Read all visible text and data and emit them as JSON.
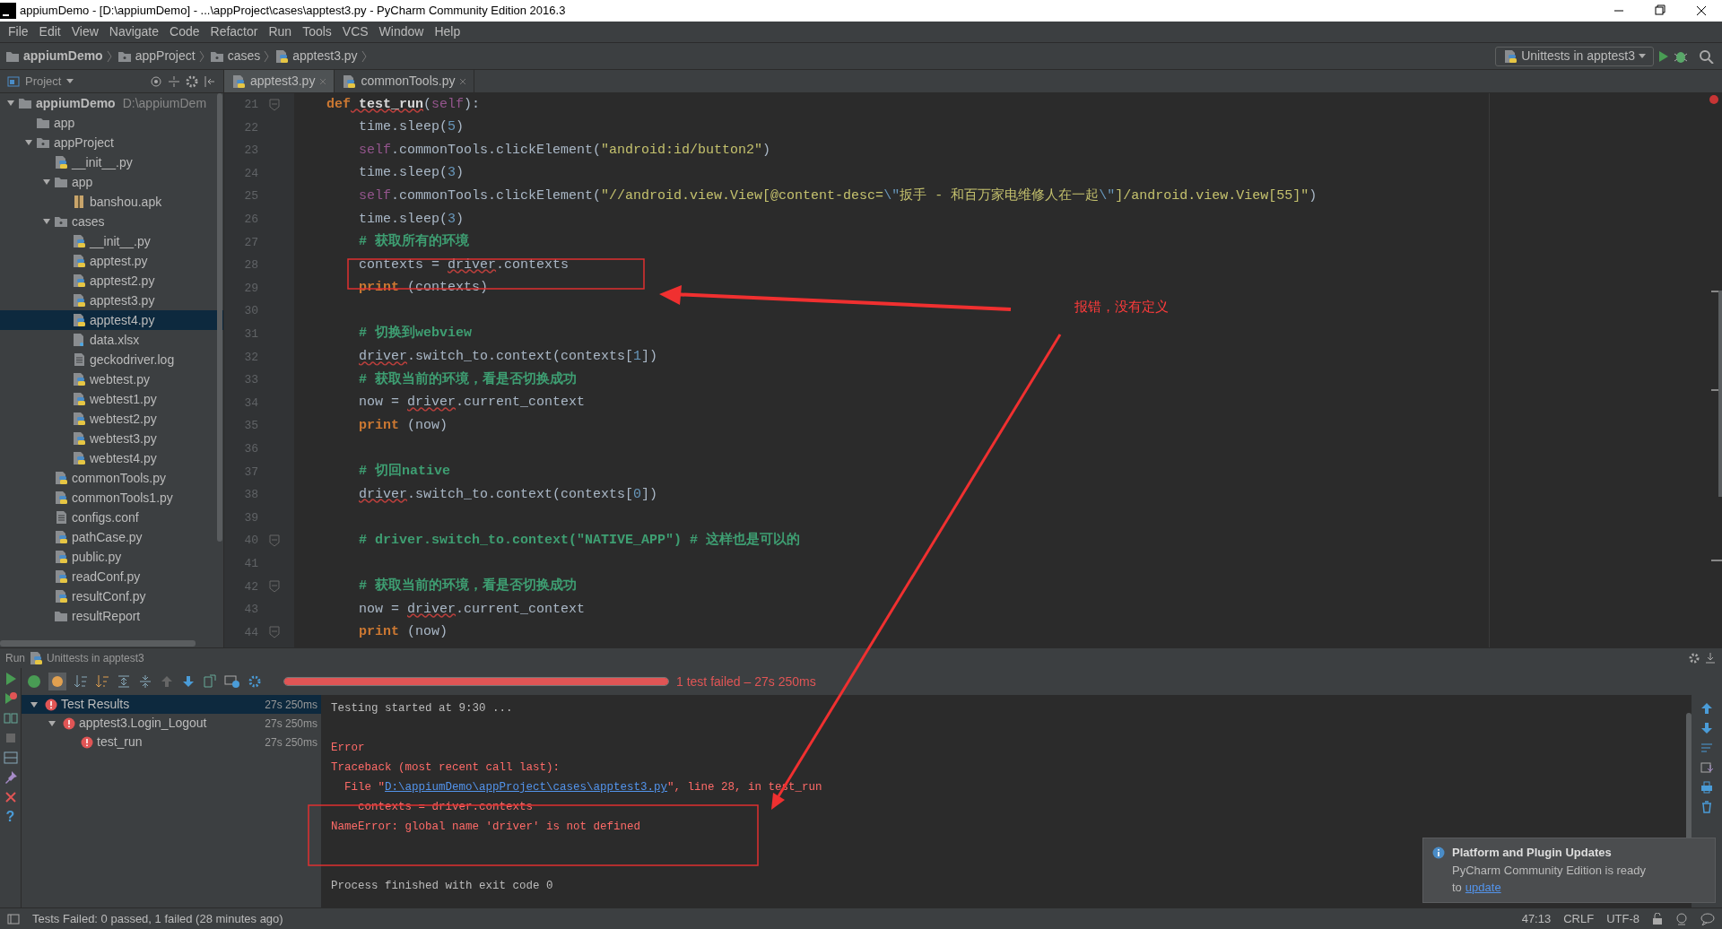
{
  "window": {
    "title": "appiumDemo - [D:\\appiumDemo] - ...\\appProject\\cases\\apptest3.py - PyCharm Community Edition 2016.3"
  },
  "menu": [
    "File",
    "Edit",
    "View",
    "Navigate",
    "Code",
    "Refactor",
    "Run",
    "Tools",
    "VCS",
    "Window",
    "Help"
  ],
  "breadcrumbs": [
    {
      "label": "appiumDemo",
      "kind": "root"
    },
    {
      "label": "appProject",
      "kind": "package"
    },
    {
      "label": "cases",
      "kind": "package"
    },
    {
      "label": "apptest3.py",
      "kind": "py"
    }
  ],
  "run_config": {
    "label": "Unittests in apptest3"
  },
  "project_panel": {
    "title": "Project"
  },
  "tabs": [
    {
      "label": "apptest3.py",
      "selected": true
    },
    {
      "label": "commonTools.py",
      "selected": false
    }
  ],
  "tree": [
    {
      "name": "appiumDemo",
      "path": "D:\\appiumDem",
      "kind": "folder",
      "expanded": true,
      "selected": false,
      "children": [
        {
          "name": "app",
          "kind": "folder",
          "selected": false
        },
        {
          "name": "appProject",
          "kind": "package",
          "expanded": true,
          "selected": false,
          "children": [
            {
              "name": "__init__.py",
              "kind": "py",
              "selected": false
            },
            {
              "name": "app",
              "kind": "folder",
              "expanded": true,
              "selected": false,
              "children": [
                {
                  "name": "banshou.apk",
                  "kind": "apk",
                  "selected": false
                }
              ]
            },
            {
              "name": "cases",
              "kind": "package",
              "expanded": true,
              "selected": false,
              "children": [
                {
                  "name": "__init__.py",
                  "kind": "py",
                  "selected": false
                },
                {
                  "name": "apptest.py",
                  "kind": "py",
                  "selected": false
                },
                {
                  "name": "apptest2.py",
                  "kind": "py",
                  "selected": false
                },
                {
                  "name": "apptest3.py",
                  "kind": "py",
                  "selected": false
                },
                {
                  "name": "apptest4.py",
                  "kind": "py",
                  "selected": true
                },
                {
                  "name": "data.xlsx",
                  "kind": "unknown",
                  "selected": false
                },
                {
                  "name": "geckodriver.log",
                  "kind": "text",
                  "selected": false
                },
                {
                  "name": "webtest.py",
                  "kind": "py",
                  "selected": false
                },
                {
                  "name": "webtest1.py",
                  "kind": "py",
                  "selected": false
                },
                {
                  "name": "webtest2.py",
                  "kind": "py",
                  "selected": false
                },
                {
                  "name": "webtest3.py",
                  "kind": "py",
                  "selected": false
                },
                {
                  "name": "webtest4.py",
                  "kind": "py",
                  "selected": false
                }
              ]
            },
            {
              "name": "commonTools.py",
              "kind": "py",
              "selected": false
            },
            {
              "name": "commonTools1.py",
              "kind": "py",
              "selected": false
            },
            {
              "name": "configs.conf",
              "kind": "text",
              "selected": false
            },
            {
              "name": "pathCase.py",
              "kind": "py",
              "selected": false
            },
            {
              "name": "public.py",
              "kind": "py",
              "selected": false
            },
            {
              "name": "readConf.py",
              "kind": "py",
              "selected": false
            },
            {
              "name": "resultConf.py",
              "kind": "py",
              "selected": false
            },
            {
              "name": "resultReport",
              "kind": "folder",
              "selected": false
            }
          ]
        }
      ]
    }
  ],
  "editor": {
    "lines": [
      {
        "no": "21",
        "kind": "def",
        "fold_marker": true,
        "segments": [
          {
            "t": "def",
            "kind": "kw"
          },
          {
            "t": " test_run",
            "kind": "fn"
          },
          {
            "t": "(",
            "kind": "plain"
          },
          {
            "t": "self",
            "kind": "self"
          },
          {
            "t": "):",
            "kind": "plain"
          }
        ]
      },
      {
        "no": "22",
        "kind": "body",
        "segments": [
          {
            "t": "time.sleep(",
            "kind": "plain"
          },
          {
            "t": "5",
            "kind": "num"
          },
          {
            "t": ")",
            "kind": "plain"
          }
        ]
      },
      {
        "no": "23",
        "kind": "body",
        "segments": [
          {
            "t": "self",
            "kind": "self"
          },
          {
            "t": ".commonTools.clickElement(",
            "kind": "plain"
          },
          {
            "t": "\"android:id/button2\"",
            "kind": "str"
          },
          {
            "t": ")",
            "kind": "plain"
          }
        ]
      },
      {
        "no": "24",
        "kind": "body",
        "segments": [
          {
            "t": "time.sleep(",
            "kind": "plain"
          },
          {
            "t": "3",
            "kind": "num"
          },
          {
            "t": ")",
            "kind": "plain"
          }
        ]
      },
      {
        "no": "25",
        "kind": "body",
        "segments": [
          {
            "t": "self",
            "kind": "self"
          },
          {
            "t": ".commonTools.clickElement(",
            "kind": "plain"
          },
          {
            "t": "\"//android.view.View[@content-desc=",
            "kind": "str"
          },
          {
            "t": "\\\"",
            "kind": "esc"
          },
          {
            "t": "扳手 - 和百万家电维修人在一起",
            "kind": "str"
          },
          {
            "t": "\\\"",
            "kind": "esc"
          },
          {
            "t": "]/android.view.View[55]\"",
            "kind": "str"
          },
          {
            "t": ")",
            "kind": "plain"
          }
        ]
      },
      {
        "no": "26",
        "kind": "body",
        "segments": [
          {
            "t": "time.sleep(",
            "kind": "plain"
          },
          {
            "t": "3",
            "kind": "num"
          },
          {
            "t": ")",
            "kind": "plain"
          }
        ]
      },
      {
        "no": "27",
        "kind": "body",
        "segments": [
          {
            "t": "# 获取所有的环境",
            "kind": "cmt"
          }
        ]
      },
      {
        "no": "28",
        "kind": "body",
        "segments": [
          {
            "t": "contexts = ",
            "kind": "plain"
          },
          {
            "t": "driver",
            "kind": "warn"
          },
          {
            "t": ".contexts",
            "kind": "plain"
          }
        ]
      },
      {
        "no": "29",
        "kind": "body",
        "segments": [
          {
            "t": "print",
            "kind": "kw"
          },
          {
            "t": " (contexts)",
            "kind": "plain"
          }
        ]
      },
      {
        "no": "30",
        "kind": "blank"
      },
      {
        "no": "31",
        "kind": "body",
        "segments": [
          {
            "t": "# 切换到webview",
            "kind": "cmt"
          }
        ]
      },
      {
        "no": "32",
        "kind": "body",
        "segments": [
          {
            "t": "driver",
            "kind": "warn"
          },
          {
            "t": ".switch_to.context(contexts[",
            "kind": "plain"
          },
          {
            "t": "1",
            "kind": "num"
          },
          {
            "t": "])",
            "kind": "plain"
          }
        ]
      },
      {
        "no": "33",
        "kind": "body",
        "segments": [
          {
            "t": "# 获取当前的环境，看是否切换成功",
            "kind": "cmt"
          }
        ]
      },
      {
        "no": "34",
        "kind": "body",
        "segments": [
          {
            "t": "now = ",
            "kind": "plain"
          },
          {
            "t": "driver",
            "kind": "warn"
          },
          {
            "t": ".current_context",
            "kind": "plain"
          }
        ]
      },
      {
        "no": "35",
        "kind": "body",
        "segments": [
          {
            "t": "print",
            "kind": "kw"
          },
          {
            "t": " (now)",
            "kind": "plain"
          }
        ]
      },
      {
        "no": "36",
        "kind": "blank"
      },
      {
        "no": "37",
        "kind": "body",
        "segments": [
          {
            "t": "# 切回native",
            "kind": "cmt"
          }
        ]
      },
      {
        "no": "38",
        "kind": "body",
        "segments": [
          {
            "t": "driver",
            "kind": "warn"
          },
          {
            "t": ".switch_to.context(contexts[",
            "kind": "plain"
          },
          {
            "t": "0",
            "kind": "num"
          },
          {
            "t": "])",
            "kind": "plain"
          }
        ]
      },
      {
        "no": "39",
        "kind": "blank"
      },
      {
        "no": "40",
        "kind": "body",
        "fold_marker": true,
        "segments": [
          {
            "t": "# driver.switch_to.context(\"NATIVE_APP\") # 这样也是可以的",
            "kind": "cmt"
          }
        ]
      },
      {
        "no": "41",
        "kind": "blank"
      },
      {
        "no": "42",
        "kind": "body",
        "fold_marker": true,
        "segments": [
          {
            "t": "# 获取当前的环境，看是否切换成功",
            "kind": "cmt"
          }
        ]
      },
      {
        "no": "43",
        "kind": "body",
        "segments": [
          {
            "t": "now = ",
            "kind": "plain"
          },
          {
            "t": "driver",
            "kind": "warn"
          },
          {
            "t": ".current_context",
            "kind": "plain"
          }
        ]
      },
      {
        "no": "44",
        "kind": "body",
        "fold_marker": true,
        "segments": [
          {
            "t": "print",
            "kind": "kw"
          },
          {
            "t": " (now)",
            "kind": "plain"
          }
        ]
      }
    ]
  },
  "run_panel": {
    "label": "Run",
    "config": "Unittests in apptest3",
    "progress": {
      "failed": true,
      "level": 1,
      "text": "1 test failed – 27s 250ms"
    },
    "results": [
      {
        "name": "Test Results",
        "time": "27s 250ms",
        "failed": true,
        "expanded": true,
        "selected": true,
        "children": [
          {
            "name": "apptest3.Login_Logout",
            "time": "27s 250ms",
            "failed": true,
            "expanded": true,
            "selected": false,
            "children": [
              {
                "name": "test_run",
                "time": "27s 250ms",
                "failed": true,
                "selected": false
              }
            ]
          }
        ]
      }
    ],
    "console": [
      {
        "kind": "info",
        "parts": [
          {
            "text": "Testing started at 9:30 ...",
            "kind": "text"
          }
        ]
      },
      {
        "kind": "gap"
      },
      {
        "kind": "error",
        "parts": [
          {
            "text": "Error",
            "kind": "text"
          }
        ]
      },
      {
        "kind": "error",
        "parts": [
          {
            "text": "Traceback (most recent call last):",
            "kind": "text"
          }
        ]
      },
      {
        "kind": "error",
        "parts": [
          {
            "text": "  File \"",
            "kind": "text"
          },
          {
            "text": "D:\\appiumDemo\\appProject\\cases\\apptest3.py",
            "kind": "link"
          },
          {
            "text": "\", line 28, in test_run",
            "kind": "text"
          }
        ]
      },
      {
        "kind": "error",
        "parts": [
          {
            "text": "    contexts = driver.contexts",
            "kind": "text"
          }
        ]
      },
      {
        "kind": "error",
        "parts": [
          {
            "text": "NameError: global name 'driver' is not defined",
            "kind": "text"
          }
        ]
      },
      {
        "kind": "gap"
      },
      {
        "kind": "gap"
      },
      {
        "kind": "info",
        "parts": [
          {
            "text": "Process finished with exit code 0",
            "kind": "text"
          }
        ]
      }
    ],
    "help_glyph": "?"
  },
  "notification": {
    "title": "Platform and Plugin Updates",
    "body": "PyCharm Community Edition is ready",
    "prefix": "to",
    "link": "update"
  },
  "annotation": {
    "note": "报错，没有定义"
  },
  "status_bar": {
    "message": "Tests Failed: 0 passed, 1 failed (28 minutes ago)",
    "position": "47:13",
    "line_ending": "CRLF",
    "encoding": "UTF-8"
  }
}
